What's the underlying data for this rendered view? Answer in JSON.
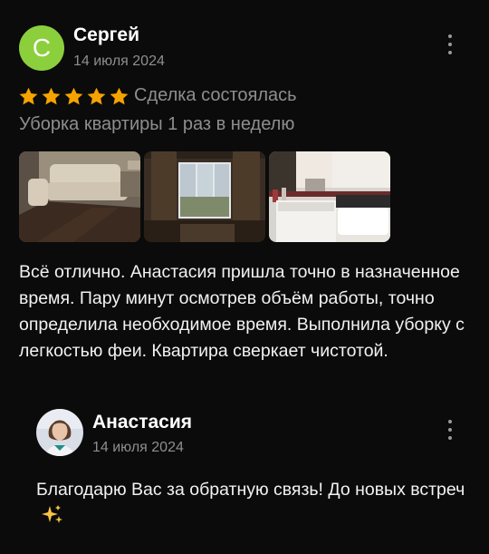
{
  "colors": {
    "background": "#0b0b0b",
    "avatar_green": "#8ccf3d",
    "star_orange": "#f5a300",
    "muted_text": "#8e8e8e"
  },
  "review": {
    "author": {
      "initial": "С",
      "name": "Сергей",
      "date": "14 июля 2024"
    },
    "rating": 5,
    "status": "Сделка состоялась",
    "service": "Уборка квартиры 1 раз в неделю",
    "photos": [
      "living-room-photo",
      "window-room-photo",
      "bathroom-photo"
    ],
    "text": "Всё отлично. Анастасия пришла точно в назначенное время. Пару минут осмотрев объём работы, точно определила необходимое время. Выполнила уборку с легкостью феи. Квартира сверкает чистотой."
  },
  "reply": {
    "author": {
      "name": "Анастасия",
      "date": "14 июля 2024"
    },
    "text": "Благодарю Вас за обратную связь!  До новых встреч",
    "emoji": "sparkles-icon"
  }
}
